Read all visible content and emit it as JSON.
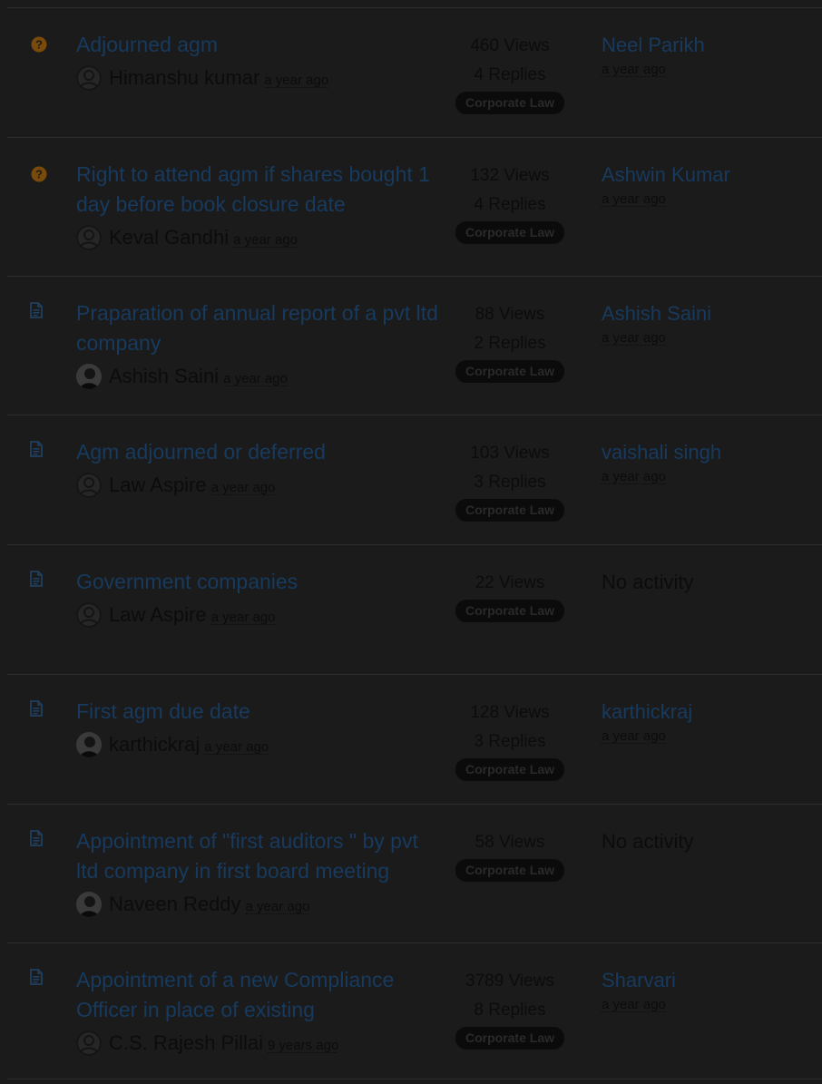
{
  "colors": {
    "background": "#1b1b1b",
    "link": "#173a5e",
    "text": "#0c0c0c",
    "question_icon": "#7a4a0a",
    "doc_icon": "#1f3f60",
    "tag_bg": "#0b0b0b"
  },
  "topics": [
    {
      "status_icon": "question-icon",
      "title": "Adjourned agm",
      "author": "Himanshu kumar",
      "author_avatar": "default-avatar",
      "posted": "a year ago",
      "views": "460 Views",
      "replies": "4 Replies",
      "category": "Corporate Law",
      "last_user": "Neel Parikh",
      "last_ago": "a year ago"
    },
    {
      "status_icon": "question-icon",
      "title": "Right to attend agm if shares bought 1 day before book closure date",
      "author": "Keval Gandhi",
      "author_avatar": "default-avatar",
      "posted": "a year ago",
      "views": "132 Views",
      "replies": "4 Replies",
      "category": "Corporate Law",
      "last_user": "Ashwin Kumar",
      "last_ago": "a year ago"
    },
    {
      "status_icon": "document-icon",
      "title": "Praparation of annual report of a pvt ltd company",
      "author": "Ashish Saini",
      "author_avatar": "photo-avatar",
      "posted": "a year ago",
      "views": "88 Views",
      "replies": "2 Replies",
      "category": "Corporate Law",
      "last_user": "Ashish Saini",
      "last_ago": "a year ago"
    },
    {
      "status_icon": "document-icon",
      "title": "Agm adjourned or deferred",
      "author": "Law Aspire",
      "author_avatar": "default-avatar",
      "posted": "a year ago",
      "views": "103 Views",
      "replies": "3 Replies",
      "category": "Corporate Law",
      "last_user": "vaishali singh",
      "last_ago": "a year ago"
    },
    {
      "status_icon": "document-icon",
      "title": "Government companies",
      "author": "Law Aspire",
      "author_avatar": "default-avatar",
      "posted": "a year ago",
      "views": "22 Views",
      "replies": "",
      "category": "Corporate Law",
      "no_activity": "No activity"
    },
    {
      "status_icon": "document-icon",
      "title": "First agm due date",
      "author": "karthickraj",
      "author_avatar": "photo-avatar",
      "posted": "a year ago",
      "views": "128 Views",
      "replies": "3 Replies",
      "category": "Corporate Law",
      "last_user": "karthickraj",
      "last_ago": "a year ago"
    },
    {
      "status_icon": "document-icon",
      "title": "Appointment of \"first auditors \" by pvt ltd company in first board meeting",
      "author": "Naveen Reddy",
      "author_avatar": "photo-avatar",
      "posted": "a year ago",
      "views": "58 Views",
      "replies": "",
      "category": "Corporate Law",
      "no_activity": "No activity"
    },
    {
      "status_icon": "document-icon",
      "title": "Appointment of a new Compliance Officer in place of existing",
      "author": "C.S. Rajesh Pillai",
      "author_avatar": "default-avatar",
      "posted": "9 years ago",
      "views": "3789 Views",
      "replies": "8 Replies",
      "category": "Corporate Law",
      "last_user": "Sharvari",
      "last_ago": "a year ago"
    }
  ]
}
